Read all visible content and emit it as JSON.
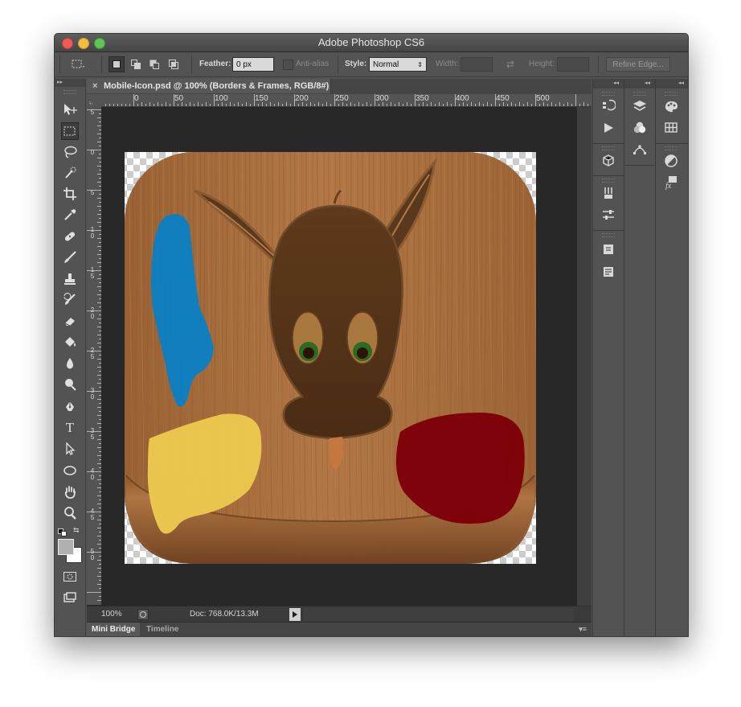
{
  "window": {
    "title": "Adobe Photoshop CS6"
  },
  "options_bar": {
    "feather_label": "Feather:",
    "feather_value": "0 px",
    "antialias_label": "Anti-alias",
    "style_label": "Style:",
    "style_value": "Normal",
    "width_label": "Width:",
    "height_label": "Height:",
    "refine_edge_label": "Refine Edge..."
  },
  "document": {
    "tab_title": "Mobile-Icon.psd @ 100% (Borders & Frames, RGB/8#)",
    "close_glyph": "×",
    "ruler_h_labels": [
      "0",
      "50",
      "100",
      "150",
      "200",
      "250",
      "300",
      "350",
      "400",
      "450",
      "500"
    ],
    "ruler_v_labels": [
      "5",
      "0",
      "5",
      "1 0",
      "1 5",
      "2 0",
      "2 5",
      "3 0",
      "3 5",
      "4 0",
      "4 5",
      "5 0"
    ]
  },
  "status": {
    "zoom": "100%",
    "doc_info": "Doc: 768.0K/13.3M"
  },
  "bottom_tabs": [
    {
      "label": "Mini Bridge"
    },
    {
      "label": "Timeline"
    }
  ],
  "tools": [
    "move-tool",
    "marquee-tool",
    "lasso-tool",
    "quick-selection-tool",
    "crop-tool",
    "eyedropper-tool",
    "healing-brush-tool",
    "brush-tool",
    "clone-stamp-tool",
    "history-brush-tool",
    "eraser-tool",
    "paint-bucket-tool",
    "blur-tool",
    "dodge-tool",
    "pen-tool",
    "type-tool",
    "path-selection-tool",
    "shape-tool",
    "hand-tool",
    "zoom-tool"
  ],
  "colors": {
    "foreground": "#b0b0b0",
    "background": "#ffffff",
    "blue_paint": "#0a7fc4",
    "yellow_paint": "#ecc84e",
    "red_paint": "#7d0008"
  }
}
